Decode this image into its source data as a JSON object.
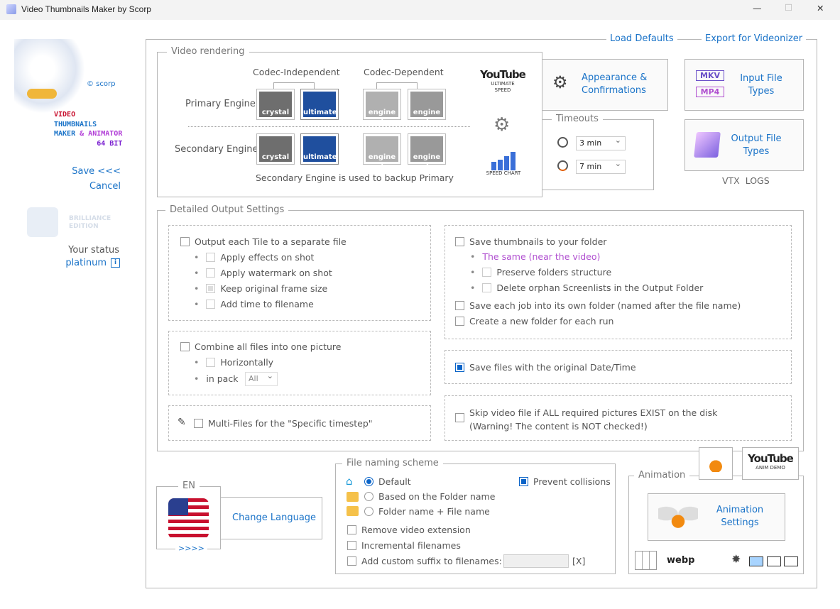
{
  "window": {
    "title": "Video Thumbnails Maker by Scorp",
    "minimize": "—",
    "maximize": "☐",
    "close": "✕"
  },
  "sidebar": {
    "copyright": "© scorp",
    "logo_lines": [
      "VIDEO",
      "THUMBNAILS",
      "MAKER",
      "& ANIMATOR",
      "64 BIT"
    ],
    "save": "Save <<<",
    "cancel": "Cancel",
    "edition": "BRILLIANCE EDITION",
    "status_label": "Your status",
    "status_value": "platinum",
    "info_icon": "i"
  },
  "top_links": {
    "load_defaults": "Load Defaults",
    "export": "Export for Videonizer"
  },
  "video_rendering": {
    "legend": "Video rendering",
    "codec_independent": "Codec-Independent",
    "codec_dependent": "Codec-Dependent",
    "primary": "Primary Engine",
    "secondary": "Secondary Engine",
    "engines": [
      "crystal",
      "ultimate",
      "engine 1",
      "engine 2"
    ],
    "selected_primary": "ultimate",
    "selected_secondary": "ultimate",
    "note": "Secondary Engine is used to backup Primary",
    "youtube": "YouTube",
    "ultimate_speed": "ULTIMATE SPEED",
    "speed_chart": "SPEED CHART"
  },
  "appearance": {
    "label": "Appearance & Confirmations"
  },
  "timeouts": {
    "legend": "Timeouts",
    "first": "3 min",
    "second": "7 min"
  },
  "input_types": {
    "label": "Input File Types",
    "badges": [
      "MKV",
      "MP4"
    ]
  },
  "output_types": {
    "label": "Output File Types"
  },
  "vtx_logs": "VTX  LOGS",
  "detailed": {
    "legend": "Detailed Output Settings",
    "tile": {
      "label": "Output each Tile to a separate file",
      "subs": [
        "Apply effects on shot",
        "Apply watermark on shot",
        "Keep original frame size",
        "Add time to filename"
      ]
    },
    "combine": {
      "label": "Combine all files into one picture",
      "horizontally": "Horizontally",
      "in_pack": "in pack",
      "pack_value": "All"
    },
    "multi": "Multi-Files for the \"Specific timestep\"",
    "save_folder": {
      "label": "Save thumbnails to your folder",
      "same": "The same (near the video)",
      "preserve": "Preserve folders structure",
      "orphan": "Delete orphan Screenlists in the Output Folder",
      "each_job": "Save each job into its own folder (named after the file name)",
      "new_folder": "Create a new folder for each run"
    },
    "orig_date": "Save files with the original Date/Time",
    "skip": [
      "Skip video file if ALL required pictures EXIST on the disk",
      "(Warning! The content is NOT checked!)"
    ]
  },
  "language": {
    "legend": "EN",
    "button": "Change Language",
    "more": ">>>>"
  },
  "naming": {
    "legend": "File naming scheme",
    "options": [
      "Default",
      "Based on the Folder name",
      "Folder name + File name"
    ],
    "prevent": "Prevent collisions",
    "remove_ext": "Remove video extension",
    "incremental": "Incremental filenames",
    "suffix": "Add custom suffix to filenames:",
    "suffix_value": "",
    "clear": "[X]"
  },
  "animation": {
    "legend": "Animation",
    "button": "Animation Settings",
    "anim_demo": "ANIM DEMO",
    "youtube": "YouTube",
    "webp": "webp"
  }
}
